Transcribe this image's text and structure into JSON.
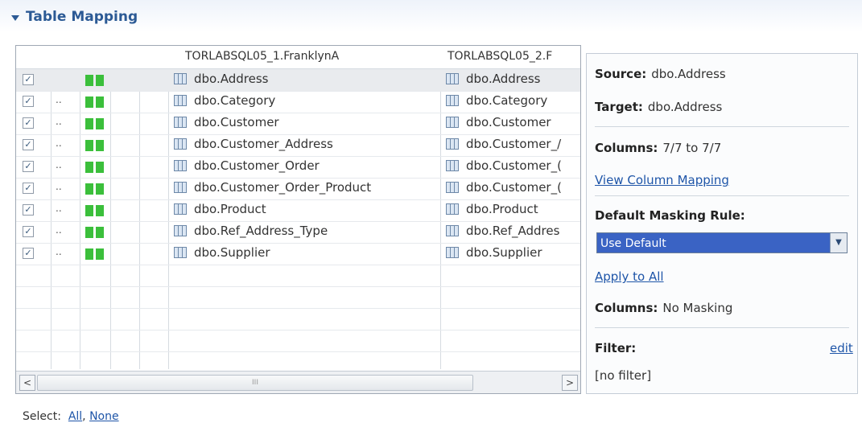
{
  "section": {
    "title": "Table Mapping"
  },
  "table": {
    "source_header": "TORLABSQL05_1.FranklynA",
    "target_header": "TORLABSQL05_2.F",
    "rows": [
      {
        "source": "dbo.Address",
        "target": "dbo.Address",
        "marker": ""
      },
      {
        "source": "dbo.Category",
        "target": "dbo.Category",
        "marker": ".."
      },
      {
        "source": "dbo.Customer",
        "target": "dbo.Customer",
        "marker": ".."
      },
      {
        "source": "dbo.Customer_Address",
        "target": "dbo.Customer_/",
        "marker": ".."
      },
      {
        "source": "dbo.Customer_Order",
        "target": "dbo.Customer_(",
        "marker": ".."
      },
      {
        "source": "dbo.Customer_Order_Product",
        "target": "dbo.Customer_(",
        "marker": ".."
      },
      {
        "source": "dbo.Product",
        "target": "dbo.Product",
        "marker": ".."
      },
      {
        "source": "dbo.Ref_Address_Type",
        "target": "dbo.Ref_Addres",
        "marker": ".."
      },
      {
        "source": "dbo.Supplier",
        "target": "dbo.Supplier",
        "marker": ".."
      }
    ],
    "status_color": "#3bbf3b",
    "scroll_left": "<",
    "scroll_right": ">",
    "thumb_grip": "III"
  },
  "details": {
    "source_label": "Source:",
    "source_value": "dbo.Address",
    "target_label": "Target:",
    "target_value": "dbo.Address",
    "columns_label": "Columns:",
    "columns_value": "7/7 to 7/7",
    "view_mapping_link": "View Column Mapping",
    "masking_rule_label": "Default Masking Rule:",
    "masking_rule_value": "Use Default",
    "apply_all_link": "Apply to All",
    "columns2_label": "Columns:",
    "columns2_value": "No Masking",
    "filter_label": "Filter:",
    "filter_edit_link": "edit",
    "filter_value": "[no filter]"
  },
  "footer": {
    "select_label": "Select:",
    "all_link": "All",
    "separator": ",",
    "none_link": "None"
  }
}
